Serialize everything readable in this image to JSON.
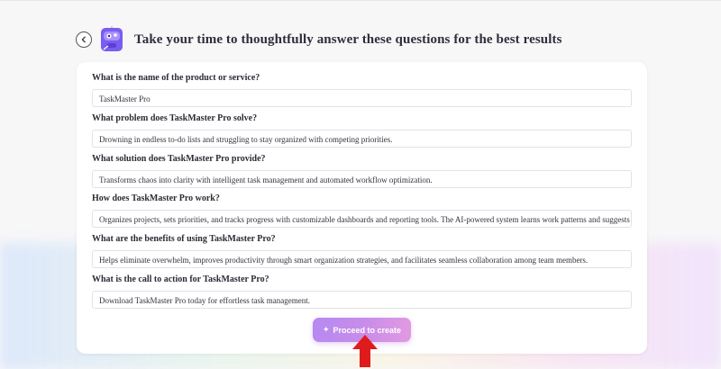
{
  "header": {
    "title": "Take your time to thoughtfully answer these questions for the best results",
    "back_icon": "chevron-left-icon",
    "logo_icon": "robot-mascot-icon"
  },
  "questions": [
    {
      "label": "What is the name of the product or service?",
      "value": "TaskMaster Pro"
    },
    {
      "label": "What problem does TaskMaster Pro solve?",
      "value": "Drowning in endless to-do lists and struggling to stay organized with competing priorities."
    },
    {
      "label": "What solution does TaskMaster Pro provide?",
      "value": "Transforms chaos into clarity with intelligent task management and automated workflow optimization."
    },
    {
      "label": "How does TaskMaster Pro work?",
      "value": "Organizes projects, sets priorities, and tracks progress with customizable dashboards and reporting tools. The AI-powered system learns work patterns and suggests optimal sch"
    },
    {
      "label": "What are the benefits of using TaskMaster Pro?",
      "value": "Helps eliminate overwhelm, improves productivity through smart organization strategies, and facilitates seamless collaboration among team members."
    },
    {
      "label": "What is the call to action for TaskMaster Pro?",
      "value": "Download TaskMaster Pro today for effortless task management."
    }
  ],
  "actions": {
    "proceed_label": "Proceed to create",
    "proceed_icon": "sparkle-icon"
  },
  "colors": {
    "accent_gradient_start": "#b689f2",
    "accent_gradient_end": "#e19ae0",
    "arrow": "#e01b1b"
  }
}
